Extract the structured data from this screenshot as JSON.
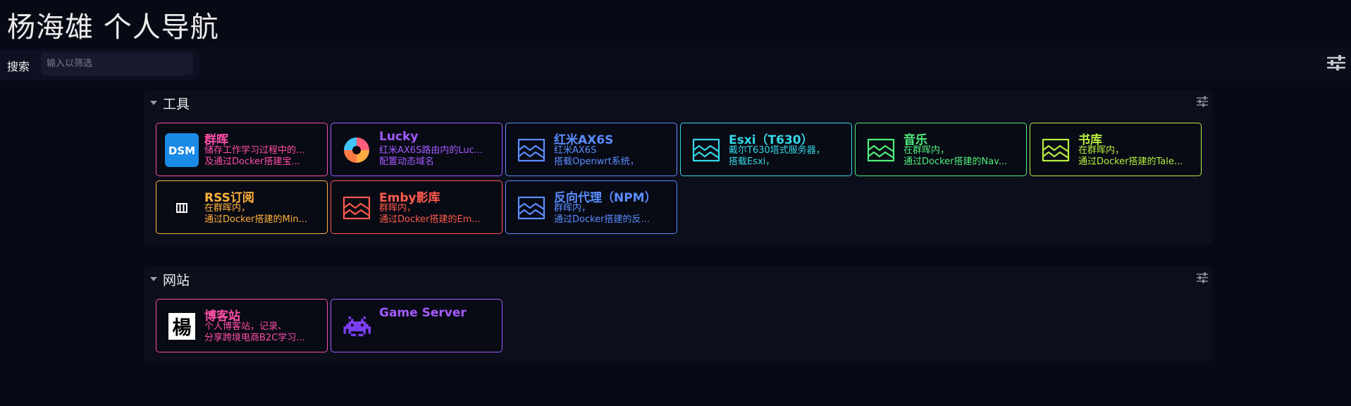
{
  "header": {
    "title": "杨海雄 个人导航"
  },
  "search": {
    "label": "搜索",
    "placeholder": "输入以筛选",
    "value": ""
  },
  "sections": [
    {
      "title": "工具",
      "cards": [
        {
          "name": "群晖",
          "desc1": "储存工作学习过程中的...",
          "desc2": "及通过Docker搭建宝...",
          "color": "#ff4fa8",
          "icon": "dsm-logo-icon"
        },
        {
          "name": "Lucky",
          "desc1": "红米AX6S路由内的Luc...",
          "desc2": "配置动态域名",
          "color": "#a35bff",
          "icon": "lucky-logo-icon"
        },
        {
          "name": "红米AX6S",
          "desc1": "红米AX6S",
          "desc2": "搭载Openwrt系统，",
          "color": "#5a8dff",
          "icon": "image-placeholder-icon"
        },
        {
          "name": "Esxi（T630）",
          "desc1": "戴尔T630塔式服务器，",
          "desc2": "搭载Esxi，",
          "color": "#37d8e8",
          "icon": "image-placeholder-icon"
        },
        {
          "name": "音乐",
          "desc1": "在群晖内，",
          "desc2": "通过Docker搭建的Nav...",
          "color": "#4ff07a",
          "icon": "image-placeholder-icon"
        },
        {
          "name": "书库",
          "desc1": "在群晖内，",
          "desc2": "通过Docker搭建的Tale...",
          "color": "#b7ef3d",
          "icon": "image-placeholder-icon"
        },
        {
          "name": "RSS订阅",
          "desc1": "在群晖内，",
          "desc2": "通过Docker搭建的Min...",
          "color": "#ffb23d",
          "icon": "rss-miniflux-icon"
        },
        {
          "name": "Emby影库",
          "desc1": "群晖内，",
          "desc2": "通过Docker搭建的Em...",
          "color": "#ff5a4d",
          "icon": "image-placeholder-icon"
        },
        {
          "name": "反向代理（NPM）",
          "desc1": "群晖内，",
          "desc2": "通过Docker搭建的反...",
          "color": "#5a8dff",
          "icon": "image-placeholder-icon"
        }
      ]
    },
    {
      "title": "网站",
      "cards": [
        {
          "name": "博客站",
          "desc1": "个人博客站，记录、",
          "desc2": "分享跨境电商B2C学习...",
          "color": "#ff4fa8",
          "icon": "yang-character-icon",
          "icon_text": "楊"
        },
        {
          "name": "Game Server",
          "desc1": "",
          "desc2": "",
          "color": "#a35bff",
          "icon": "space-invader-icon"
        }
      ]
    }
  ]
}
